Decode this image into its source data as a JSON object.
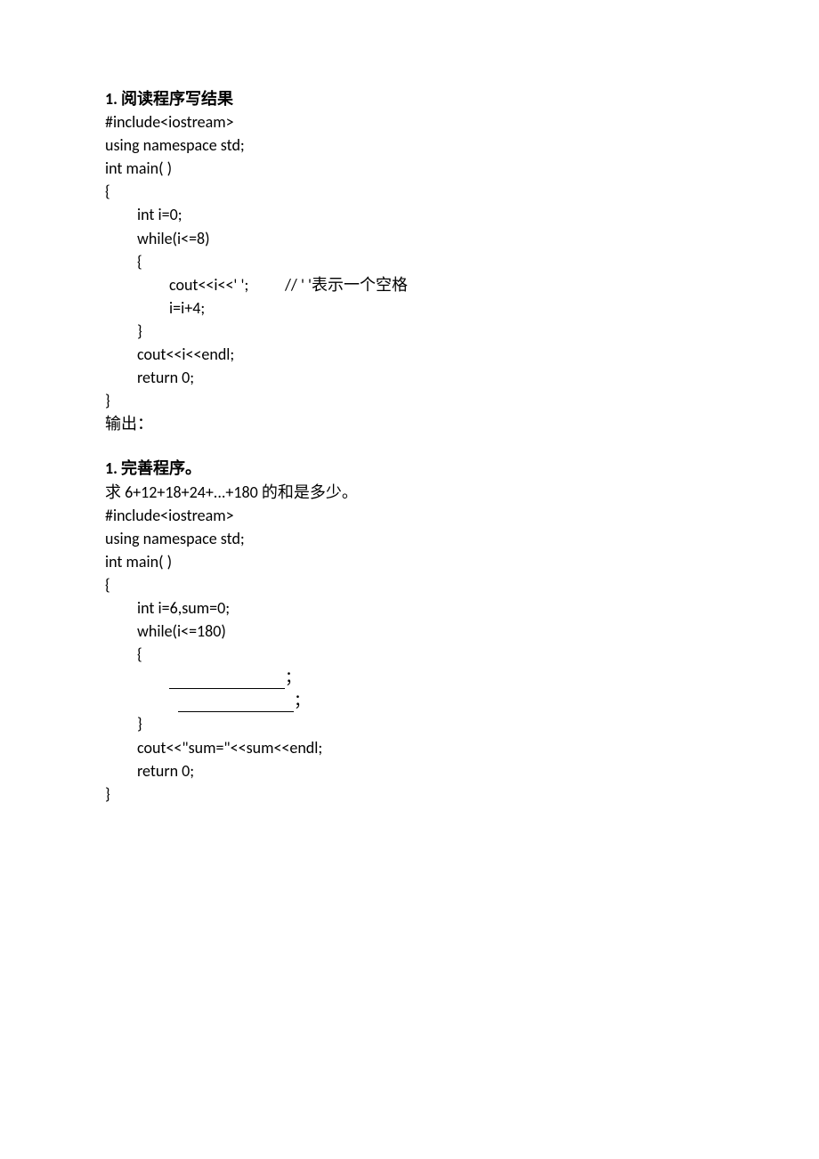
{
  "section1": {
    "title": "1. 阅读程序写结果",
    "code": {
      "l1": "#include<iostream>",
      "l2": "using namespace std;",
      "l3": "int main( )",
      "l4": "{",
      "l5": "int i=0;",
      "l6": "while(i<=8)",
      "l7": "{",
      "l8a": "cout<<i<<' ';",
      "l8b": "// ' '表示一个空格",
      "l9": "i=i+4;",
      "l10": "}",
      "l11": "cout<<i<<endl;",
      "l12": "return 0;",
      "l13": "}"
    },
    "output_label": "输出："
  },
  "section2": {
    "title": "1. 完善程序。",
    "desc": "求 6+12+18+24+...+180 的和是多少。",
    "code": {
      "l1": "#include<iostream>",
      "l2": "using namespace std;",
      "l3": "int main( )",
      "l4": "{",
      "l5": "int i=6,sum=0;",
      "l6": "while(i<=180)",
      "l7": "{",
      "blank_suffix": " ；",
      "l10": "}",
      "l11": "cout<<\"sum=\"<<sum<<endl;",
      "l12": "return 0;",
      "l13": "}"
    }
  }
}
